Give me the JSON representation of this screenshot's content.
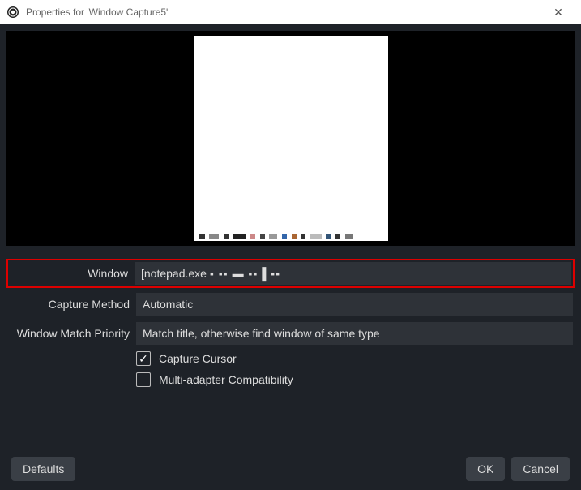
{
  "titlebar": {
    "title": "Properties for 'Window Capture5'"
  },
  "form": {
    "window_label": "Window",
    "window_value": "[notepad.exe",
    "window_obscured": "▪  ▪▪  ▬   ▪▪ ▌▪▪",
    "capture_method_label": "Capture Method",
    "capture_method_value": "Automatic",
    "match_priority_label": "Window Match Priority",
    "match_priority_value": "Match title, otherwise find window of same type",
    "capture_cursor_label": "Capture Cursor",
    "multi_adapter_label": "Multi-adapter Compatibility"
  },
  "footer": {
    "defaults": "Defaults",
    "ok": "OK",
    "cancel": "Cancel"
  }
}
